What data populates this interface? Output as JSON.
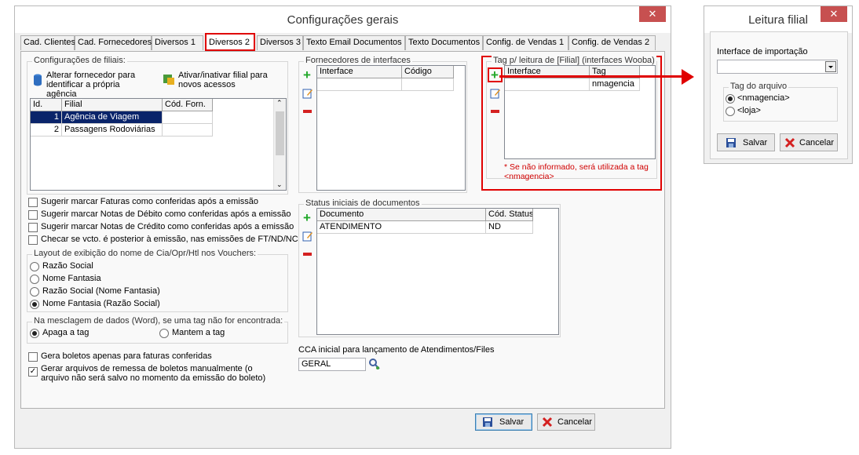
{
  "main_window": {
    "title": "Configurações gerais",
    "close_label": "✕",
    "tabs": [
      "Cad. Clientes",
      "Cad. Fornecedores",
      "Diversos 1",
      "Diversos 2",
      "Diversos 3",
      "Texto Email Documentos",
      "Texto Documentos",
      "Config. de Vendas 1",
      "Config. de Vendas 2"
    ],
    "active_tab": "Diversos 2",
    "filiais": {
      "group_label": "Configurações de filiais:",
      "btn_alterar": "Alterar fornecedor para identificar a própria agência",
      "btn_ativar": "Ativar/inativar filial para novos acessos",
      "columns": [
        "Id.",
        "Filial",
        "Cód. Forn."
      ],
      "rows": [
        {
          "id": "1",
          "filial": "Agência de Viagem",
          "cod": ""
        },
        {
          "id": "2",
          "filial": "Passagens Rodoviárias",
          "cod": ""
        }
      ]
    },
    "checks": [
      {
        "label": "Sugerir marcar Faturas como conferidas após a emissão",
        "checked": false
      },
      {
        "label": "Sugerir marcar Notas de Débito como conferidas após a emissão",
        "checked": false
      },
      {
        "label": "Sugerir marcar Notas de Crédito como conferidas após a emissão",
        "checked": false
      },
      {
        "label": "Checar se vcto. é posterior à emissão, nas emissões de FT/ND/NC",
        "checked": false
      }
    ],
    "layout_group": {
      "label": "Layout de exibição do nome de Cia/Opr/Htl nos Vouchers:",
      "options": [
        "Razão Social",
        "Nome Fantasia",
        "Razão Social (Nome Fantasia)",
        "Nome Fantasia (Razão Social)"
      ],
      "selected": 3
    },
    "mescla_group": {
      "label": "Na mesclagem de dados (Word), se uma tag não for encontrada:",
      "options": [
        "Apaga a tag",
        "Mantem a tag"
      ],
      "selected": 0
    },
    "check_boletos": {
      "label": "Gera boletos apenas para faturas conferidas",
      "checked": false
    },
    "check_remessa": {
      "label": "Gerar arquivos de remessa de boletos manualmente (o arquivo não será salvo no momento da emissão do boleto)",
      "checked": true
    },
    "fornecedores": {
      "group_label": "Fornecedores de interfaces",
      "columns": [
        "Interface",
        "Código"
      ]
    },
    "tag_group": {
      "label": "Tag p/ leitura de [Filial] (interfaces Wooba)",
      "columns": [
        "Interface",
        "Tag"
      ],
      "rows": [
        {
          "interface": "",
          "tag": "nmagencia"
        }
      ],
      "note": "* Se não informado, será utilizada a tag <nmagencia>",
      "note_color": "#d00000"
    },
    "status": {
      "group_label": "Status iniciais de documentos",
      "columns": [
        "Documento",
        "Cód. Status"
      ],
      "rows": [
        {
          "documento": "ATENDIMENTO",
          "cod": "ND"
        }
      ]
    },
    "cca": {
      "label": "CCA inicial para lançamento de Atendimentos/Files",
      "value": "GERAL"
    },
    "salvar": "Salvar",
    "cancelar": "Cancelar"
  },
  "leitura_window": {
    "title": "Leitura filial",
    "close_label": "✕",
    "interface_label": "Interface de importação",
    "interface_value": "",
    "tag_group_label": "Tag do arquivo",
    "tag_options": [
      "<nmagencia>",
      "<loja>"
    ],
    "tag_selected": 0,
    "salvar": "Salvar",
    "cancelar": "Cancelar"
  },
  "colors": {
    "highlight": "#e00000",
    "selection": "#0a246a",
    "close": "#c75050"
  },
  "icons": [
    "plus-icon",
    "edit-icon",
    "minus-icon",
    "floppy-icon",
    "cancel-x-icon",
    "search-icon",
    "arrow-right-icon"
  ]
}
